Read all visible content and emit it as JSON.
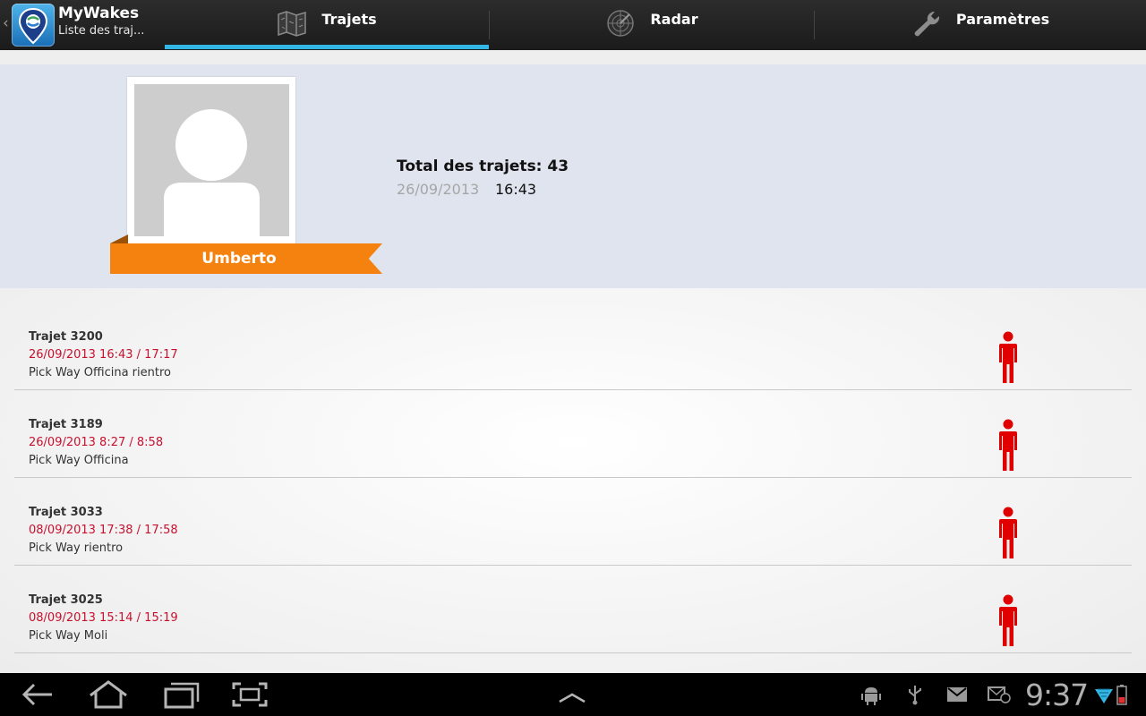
{
  "app": {
    "title": "MyWakes",
    "subtitle": "Liste des traj..."
  },
  "tabs": [
    {
      "label": "Trajets",
      "icon": "map-icon",
      "selected": true
    },
    {
      "label": "Radar",
      "icon": "radar-icon",
      "selected": false
    },
    {
      "label": "Paramètres",
      "icon": "wrench-icon",
      "selected": false
    }
  ],
  "profile": {
    "name": "Umberto",
    "total_label": "Total des trajets: 43",
    "last_date": "26/09/2013",
    "last_time": "16:43"
  },
  "trips": [
    {
      "title": "Trajet 3200",
      "time": "26/09/2013 16:43 / 17:17",
      "description": "Pick Way Officina rientro",
      "mode_icon": "pedestrian-icon"
    },
    {
      "title": "Trajet 3189",
      "time": "26/09/2013 8:27 / 8:58",
      "description": "Pick Way Officina",
      "mode_icon": "pedestrian-icon"
    },
    {
      "title": "Trajet 3033",
      "time": "08/09/2013 17:38 / 17:58",
      "description": "Pick Way rientro",
      "mode_icon": "pedestrian-icon"
    },
    {
      "title": "Trajet 3025",
      "time": "08/09/2013 15:14 / 15:19",
      "description": "Pick Way Moli",
      "mode_icon": "pedestrian-icon"
    }
  ],
  "system_bar": {
    "clock": "9:37"
  },
  "colors": {
    "accent": "#33b5e5",
    "ribbon": "#f5820e",
    "trip_time": "#c8102e",
    "pedestrian": "#e00000",
    "profile_bg": "#dfe4ee"
  }
}
